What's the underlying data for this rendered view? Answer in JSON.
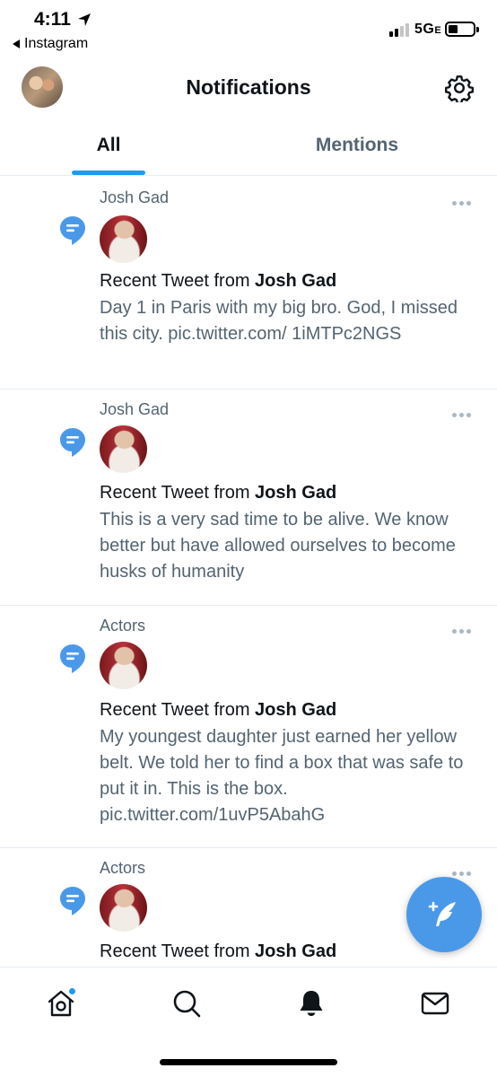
{
  "status_bar": {
    "time": "4:11",
    "back_app": "Instagram",
    "network": "5G",
    "network_suffix": "E"
  },
  "header": {
    "title": "Notifications",
    "avatar_icon": "profile-avatar",
    "settings_icon": "gear-icon"
  },
  "tabs": [
    {
      "label": "All",
      "selected": true
    },
    {
      "label": "Mentions",
      "selected": false
    }
  ],
  "notifications": [
    {
      "source": "Josh Gad",
      "headline_prefix": "Recent Tweet from ",
      "author": "Josh Gad",
      "text": "Day 1 in Paris with my big bro. God, I missed this city. pic.twitter.com/ 1iMTPc2NGS"
    },
    {
      "source": "Josh Gad",
      "headline_prefix": "Recent Tweet from ",
      "author": "Josh Gad",
      "text": "This is a very sad time to be alive. We know better but have allowed ourselves to become husks of humanity"
    },
    {
      "source": "Actors",
      "headline_prefix": "Recent Tweet from ",
      "author": "Josh Gad",
      "text": "My youngest daughter just earned her yellow belt. We told her to find a box that was safe to put it in. This is the box. pic.twitter.com/1uvP5AbahG"
    },
    {
      "source": "Actors",
      "headline_prefix": "Recent Tweet from ",
      "author": "Josh Gad",
      "text": ""
    }
  ],
  "fab": {
    "icon": "compose-tweet-icon"
  },
  "bottom_nav": [
    {
      "icon": "home-icon",
      "has_badge": true
    },
    {
      "icon": "search-icon"
    },
    {
      "icon": "bell-icon",
      "selected": true
    },
    {
      "icon": "mail-icon"
    }
  ],
  "colors": {
    "accent": "#1d9bf0",
    "fab": "#4a99e9",
    "secondary_text": "#536471",
    "divider": "#e6ecf0"
  }
}
